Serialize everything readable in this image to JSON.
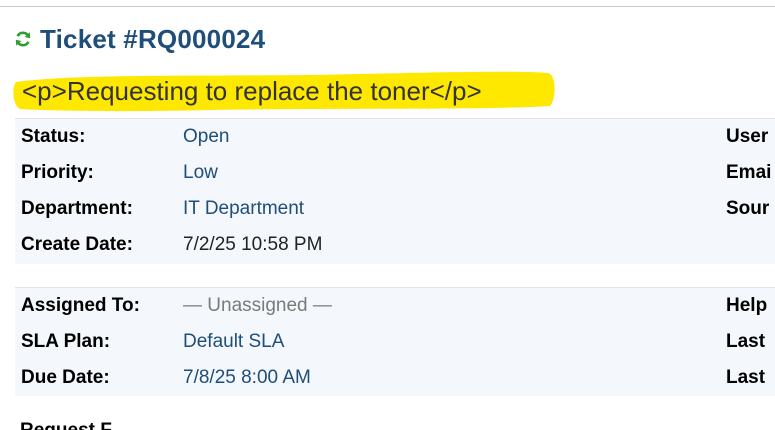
{
  "ticket": {
    "title": "Ticket #RQ000024",
    "subject": "<p>Requesting to replace the toner</p>"
  },
  "details": {
    "status_label": "Status:",
    "status_value": "Open",
    "priority_label": "Priority:",
    "priority_value": "Low",
    "department_label": "Department:",
    "department_value": "IT Department",
    "create_date_label": "Create Date:",
    "create_date_value": "7/2/25 10:58 PM",
    "right_labels": [
      "User",
      "Emai",
      "Sour"
    ]
  },
  "assignment": {
    "assigned_label": "Assigned To:",
    "assigned_value": "— Unassigned —",
    "sla_label": "SLA Plan:",
    "sla_value": "Default SLA",
    "due_label": "Due Date:",
    "due_value": "7/8/25 8:00 AM",
    "right_labels": [
      "Help",
      "Last",
      "Last"
    ]
  },
  "next_section": {
    "heading_partial": "Request F"
  },
  "colors": {
    "title": "#1e4e79",
    "link": "#1e4e79",
    "highlight": "#ffe800",
    "refresh_icon": "#2e9e2e",
    "panel_bg": "#f4f7fb"
  },
  "icons": {
    "refresh": "refresh-icon"
  }
}
